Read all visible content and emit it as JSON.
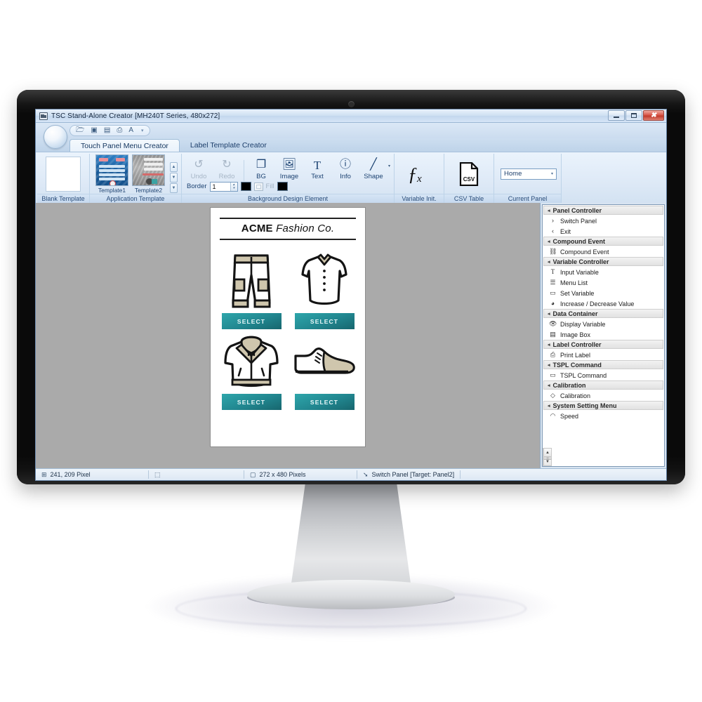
{
  "window": {
    "title": "TSC Stand-Alone Creator [MH240T Series, 480x272]",
    "app_icon": "app-window-icon",
    "minimize_icon": "minimize-icon",
    "maximize_icon": "maximize-icon",
    "close_icon": "close-icon",
    "close_glyph": "✖"
  },
  "quick_access": {
    "items": [
      {
        "name": "open-icon",
        "glyph": "🗁"
      },
      {
        "name": "save-icon",
        "glyph": "▣"
      },
      {
        "name": "save-as-icon",
        "glyph": "▤"
      },
      {
        "name": "print-icon",
        "glyph": "⎙"
      },
      {
        "name": "font-icon",
        "glyph": "A"
      }
    ],
    "caret": "▾"
  },
  "tabs": [
    {
      "label": "Touch Panel Menu Creator",
      "active": true
    },
    {
      "label": "Label Template Creator",
      "active": false
    }
  ],
  "ribbon": {
    "blank_template": {
      "group_title": "Blank Template"
    },
    "application_template": {
      "group_title": "Application Template",
      "items": [
        {
          "label": "Template1"
        },
        {
          "label": "Template2"
        }
      ],
      "scroll_up": "▲",
      "scroll_down": "▼",
      "scroll_more": "▼"
    },
    "background_design": {
      "group_title": "Background Design Element",
      "buttons": [
        {
          "label": "Undo",
          "icon": "undo-icon",
          "glyph": "↺",
          "disabled": true
        },
        {
          "label": "Redo",
          "icon": "redo-icon",
          "glyph": "↻",
          "disabled": true
        },
        {
          "label": "BG",
          "icon": "bg-layers-icon",
          "glyph": "❐",
          "disabled": false
        },
        {
          "label": "Image",
          "icon": "image-icon",
          "glyph": "🖼",
          "disabled": false
        },
        {
          "label": "Text",
          "icon": "text-icon",
          "glyph": "T",
          "disabled": false
        },
        {
          "label": "Info",
          "icon": "info-icon",
          "glyph": "ⓘ",
          "disabled": false
        },
        {
          "label": "Shape",
          "icon": "shape-line-icon",
          "glyph": "╱",
          "disabled": false
        }
      ],
      "overflow_caret": "▾",
      "border_label": "Border",
      "border_value": "1",
      "fill_label": "Fill",
      "border_color": "#000000",
      "fill_color": "#000000",
      "spin_up": "▴",
      "spin_down": "▾"
    },
    "variable_init": {
      "group_title": "Variable Init.",
      "icon": "function-fx-icon",
      "glyph": "ƒx"
    },
    "csv_table": {
      "group_title": "CSV Table",
      "icon": "csv-file-icon",
      "glyph": "CSV"
    },
    "current_panel": {
      "group_title": "Current Panel",
      "selected": "Home",
      "caret": "▾"
    }
  },
  "canvas": {
    "logo": {
      "bold_part": "ACME",
      "italic_part": "Fashion Co."
    },
    "products": [
      {
        "art": "cargo-pants-icon",
        "button_label": "SELECT"
      },
      {
        "art": "dress-shirt-icon",
        "button_label": "SELECT"
      },
      {
        "art": "hoodie-jacket-icon",
        "button_label": "SELECT"
      },
      {
        "art": "dress-shoe-icon",
        "button_label": "SELECT"
      }
    ],
    "button_color": "#21868f",
    "accent_teal": "#2ea6ab"
  },
  "sidebar": {
    "groups": [
      {
        "title": "Panel Controller",
        "collapse_glyph": "◂",
        "items": [
          {
            "label": "Switch Panel",
            "icon": "chevron-right-icon",
            "glyph": "›"
          },
          {
            "label": "Exit",
            "icon": "chevron-left-icon",
            "glyph": "‹"
          }
        ]
      },
      {
        "title": "Compound Event",
        "collapse_glyph": "◂",
        "items": [
          {
            "label": "Compound Event",
            "icon": "node-graph-icon",
            "glyph": "⛓"
          }
        ]
      },
      {
        "title": "Variable Controller",
        "collapse_glyph": "◂",
        "items": [
          {
            "label": "Input Variable",
            "icon": "text-input-icon",
            "glyph": "T"
          },
          {
            "label": "Menu List",
            "icon": "menu-list-icon",
            "glyph": "☰"
          },
          {
            "label": "Set Variable",
            "icon": "set-variable-icon",
            "glyph": "▭"
          },
          {
            "label": "Increase / Decrease Value",
            "icon": "dial-icon",
            "glyph": "◕"
          }
        ]
      },
      {
        "title": "Data Container",
        "collapse_glyph": "◂",
        "items": [
          {
            "label": "Display Variable",
            "icon": "eye-icon",
            "glyph": "👁"
          },
          {
            "label": "Image Box",
            "icon": "image-box-icon",
            "glyph": "▤"
          }
        ]
      },
      {
        "title": "Label Controller",
        "collapse_glyph": "◂",
        "items": [
          {
            "label": "Print Label",
            "icon": "printer-icon",
            "glyph": "⎙"
          }
        ]
      },
      {
        "title": "TSPL Command",
        "collapse_glyph": "◂",
        "items": [
          {
            "label": "TSPL Command",
            "icon": "command-icon",
            "glyph": "▭"
          }
        ]
      },
      {
        "title": "Calibration",
        "collapse_glyph": "◂",
        "items": [
          {
            "label": "Calibration",
            "icon": "target-icon",
            "glyph": "◇"
          }
        ]
      },
      {
        "title": "System Setting Menu",
        "collapse_glyph": "◂",
        "items": [
          {
            "label": "Speed",
            "icon": "speed-icon",
            "glyph": "◠"
          }
        ]
      }
    ],
    "scroll_up": "▲",
    "scroll_down": "▼",
    "scroll_grip": "≡"
  },
  "statusbar": {
    "cells": [
      {
        "icon": "grid-icon",
        "glyph": "⊞",
        "text": "241, 209 Pixel"
      },
      {
        "icon": "selection-icon",
        "glyph": "⬚",
        "text": ""
      },
      {
        "icon": "canvas-size-icon",
        "glyph": "▢",
        "text": "272 x 480 Pixels"
      },
      {
        "icon": "cursor-icon",
        "glyph": "➘",
        "text": "Switch Panel   [Target: Panel2]"
      }
    ]
  }
}
